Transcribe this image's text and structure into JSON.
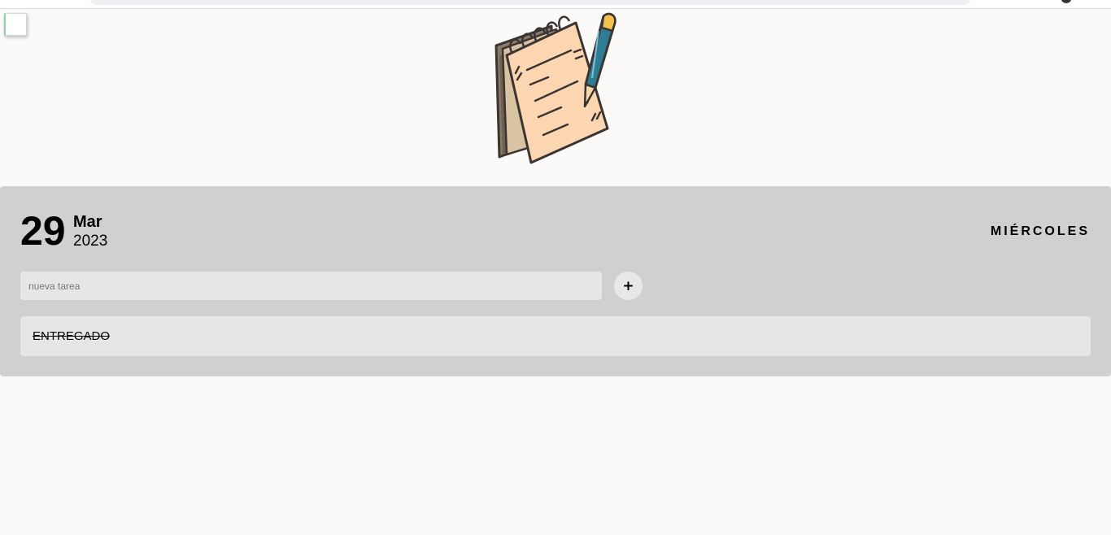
{
  "date": {
    "day": "29",
    "month": "Mar",
    "year": "2023",
    "weekday": "MIÉRCOLES"
  },
  "new_task": {
    "placeholder": "nueva tarea",
    "value": "",
    "add_label": "+"
  },
  "tasks": [
    {
      "text": "ENTREGADO",
      "completed": true
    }
  ],
  "illustration": {
    "icon": "notepad-with-pencil-icon"
  },
  "colors": {
    "page_background": "#fbfaf8",
    "panel_background": "#d0d0d0",
    "field_background": "#e6e6e6"
  }
}
